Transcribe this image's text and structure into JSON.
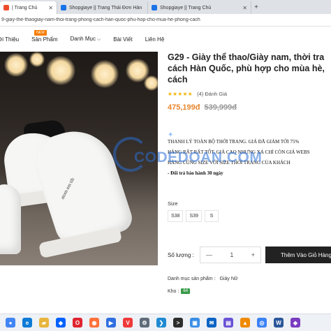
{
  "tabs": [
    {
      "label": "| Trang Chủ",
      "favicon_color": "#ee4d2d"
    },
    {
      "label": "Shopgiaye || Trang Thái Đơn Hàn",
      "favicon_color": "#1a73e8"
    },
    {
      "label": "Shopgiaye || Trang Chủ",
      "favicon_color": "#1a73e8"
    }
  ],
  "url": "9-giay-the-thaogiay-nam-thoi-trang-phong-cach-han-quoc-phu-hop-cho-mua-he-phong-cach",
  "nav": {
    "items": [
      "ới Thiệu",
      "Sản Phẩm",
      "Danh Mục",
      "Bài Viết",
      "Liên Hệ"
    ],
    "new_badge": "NEW"
  },
  "product": {
    "title_lines": [
      "G29 - Giày thể thao/Giày nam, thời tra",
      "cách Hàn Quốc, phù hợp cho mùa hè,",
      "cách"
    ],
    "stars": "★★★★★",
    "reviews": "(4) Đánh Giá",
    "price_sale": "475,199đ",
    "price_original": "539,999đ",
    "shoe_print": "atom em tih"
  },
  "promo": [
    "THANH LÝ TOÀN BỘ THỜI TRANG. GIÁ ĐÃ GIẢM TỚI 75%",
    "HÀNG RẤT RẤT TỐT. GIÁ CAO NHƯNG XẢ CHỈ CÒN GIÁ WEBS",
    "HÀNG CŨNG SIZE VỚI SIZE THỜI TRANG CỦA KHÁCH",
    "- Đổi trả bảo hành 30 ngày"
  ],
  "watermark": "CODEDOAN.COM",
  "size": {
    "label": "Size",
    "options": [
      "S38",
      "S39",
      "S"
    ]
  },
  "quantity": {
    "label": "Số lượng :",
    "minus": "—",
    "value": "1",
    "plus": "+"
  },
  "add_to_cart": "Thêm Vào Giỏ Hàng",
  "category": {
    "label": "Danh mục sản phẩm :",
    "value": "Giày Nữ"
  },
  "stock": {
    "label": "Kho :",
    "value": "64"
  },
  "taskbar_icons": [
    {
      "name": "chrome",
      "color": "#4285f4",
      "glyph": "●"
    },
    {
      "name": "edge",
      "color": "#0f7bd6",
      "glyph": "e"
    },
    {
      "name": "file-explorer",
      "color": "#e8b53c",
      "glyph": "▰"
    },
    {
      "name": "dropbox",
      "color": "#0061ff",
      "glyph": "◆"
    },
    {
      "name": "opera",
      "color": "#e0242f",
      "glyph": "O"
    },
    {
      "name": "firefox",
      "color": "#ff7139",
      "glyph": "◉"
    },
    {
      "name": "media",
      "color": "#2f6fe0",
      "glyph": "▶"
    },
    {
      "name": "vivaldi",
      "color": "#ef3939",
      "glyph": "V"
    },
    {
      "name": "settings",
      "color": "#5f6b7a",
      "glyph": "⚙"
    },
    {
      "name": "vscode",
      "color": "#1f8ad2",
      "glyph": "❯"
    },
    {
      "name": "terminal",
      "color": "#2d2d2d",
      "glyph": ">"
    },
    {
      "name": "photos",
      "color": "#3a8ee6",
      "glyph": "▣"
    },
    {
      "name": "mail",
      "color": "#0b63c4",
      "glyph": "✉"
    },
    {
      "name": "store",
      "color": "#6a52d6",
      "glyph": "▤"
    },
    {
      "name": "vlc",
      "color": "#f08a00",
      "glyph": "▲"
    },
    {
      "name": "browser",
      "color": "#3b82f6",
      "glyph": "◎"
    },
    {
      "name": "word",
      "color": "#2b579a",
      "glyph": "W"
    },
    {
      "name": "app",
      "color": "#7a3cc0",
      "glyph": "◈"
    }
  ]
}
